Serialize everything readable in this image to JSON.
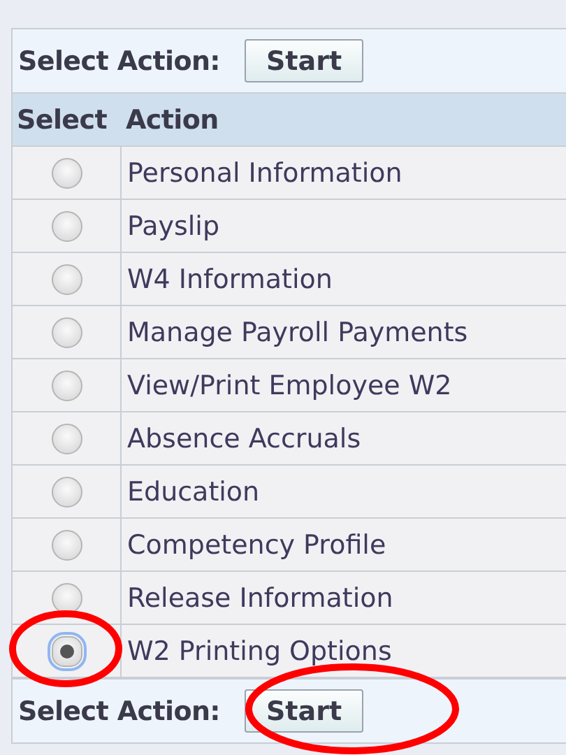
{
  "top_toolbar": {
    "label": "Select Action:",
    "button": "Start"
  },
  "table": {
    "columns": [
      "Select",
      "Action"
    ],
    "rows": [
      {
        "action": "Personal Information",
        "selected": false
      },
      {
        "action": "Payslip",
        "selected": false
      },
      {
        "action": "W4 Information",
        "selected": false
      },
      {
        "action": "Manage Payroll Payments",
        "selected": false
      },
      {
        "action": "View/Print Employee W2",
        "selected": false
      },
      {
        "action": "Absence Accruals",
        "selected": false
      },
      {
        "action": "Education",
        "selected": false
      },
      {
        "action": "Competency Profile",
        "selected": false
      },
      {
        "action": "Release Information",
        "selected": false
      },
      {
        "action": "W2 Printing Options",
        "selected": true
      }
    ]
  },
  "bottom_toolbar": {
    "label": "Select Action:",
    "button": "Start"
  }
}
